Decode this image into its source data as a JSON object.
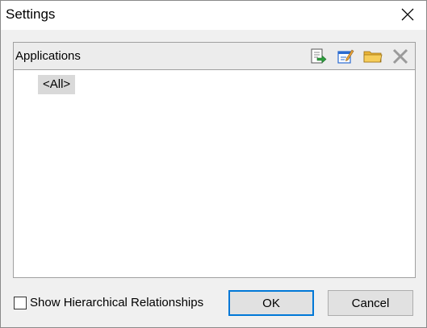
{
  "window": {
    "title": "Settings"
  },
  "panel": {
    "header_label": "Applications",
    "toolbar": [
      {
        "icon": "export-icon"
      },
      {
        "icon": "edit-icon"
      },
      {
        "icon": "folder-icon"
      },
      {
        "icon": "delete-icon"
      }
    ],
    "items": [
      {
        "label": "<All>",
        "selected": true
      }
    ]
  },
  "footer": {
    "checkbox_label": "Show Hierarchical Relationships",
    "checkbox_checked": false,
    "ok_label": "OK",
    "cancel_label": "Cancel"
  },
  "colors": {
    "accent": "#0078d7",
    "selection": "#d9d9d9",
    "folder": "#f2c94c",
    "export_arrow": "#2e9e3e",
    "edit_blue": "#2a6bd1"
  }
}
